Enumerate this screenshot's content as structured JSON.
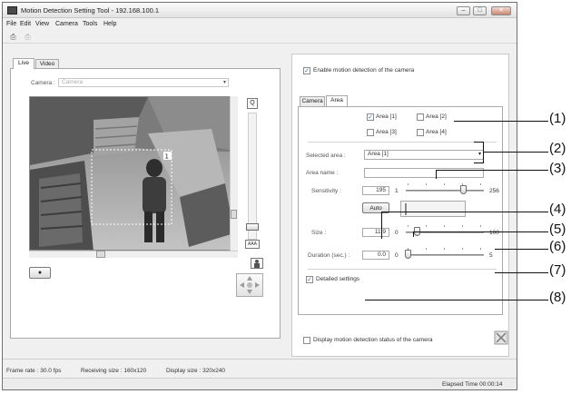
{
  "window": {
    "title": "Motion Detection Setting Tool - 192.168.100.1",
    "controls": {
      "minimize": "–",
      "maximize": "□",
      "close": "✕"
    }
  },
  "menu": [
    "File",
    "Edit",
    "View",
    "Camera",
    "Tools",
    "Help"
  ],
  "toolbar": {
    "icons": [
      "camera-connect-icon",
      "camera-disconnect-icon"
    ]
  },
  "left_panel": {
    "tabs": [
      "Live",
      "Video"
    ],
    "camera_label": "Camera :",
    "camera_value": "Camera",
    "zoom_label": "Q",
    "fit_label": "AAA",
    "record_symbol": "●"
  },
  "right_panel": {
    "enable_label": "Enable motion detection of the camera",
    "enable_checked": true,
    "tabs": [
      "Camera",
      "Area"
    ],
    "areas": [
      {
        "label": "Area [1]",
        "checked": true
      },
      {
        "label": "Area [2]",
        "checked": false
      },
      {
        "label": "Area [3]",
        "checked": false
      },
      {
        "label": "Area [4]",
        "checked": false
      }
    ],
    "selected_area_label": "Selected area :",
    "selected_area_value": "Area [1]",
    "area_name_label": "Area name :",
    "area_name_value": "",
    "sensitivity_label": "Sensitivity :",
    "sensitivity_value": "195",
    "sensitivity_min": "1",
    "sensitivity_max": "256",
    "sensitivity_level": 195,
    "auto_button": "Auto",
    "size_label": "Size :",
    "size_value": "11.9",
    "size_min": "0",
    "size_max": "100",
    "size_level": 11.9,
    "duration_label": "Duration (sec.) :",
    "duration_value": "0.0",
    "duration_min": "0",
    "duration_max": "5",
    "duration_level": 0,
    "detailed_label": "Detailed settings",
    "detailed_checked": true,
    "display_status_label": "Display motion detection status of the camera",
    "display_status_checked": false
  },
  "status": {
    "frame_rate": "Frame rate : 30.0 fps",
    "receiving_size": "Receiving size : 160x120",
    "display_size": "Display size : 320x240",
    "elapsed": "Elapsed Time 00:00:14"
  },
  "callouts": [
    "(1)",
    "(2)",
    "(3)",
    "(4)",
    "(5)",
    "(6)",
    "(7)",
    "(8)"
  ],
  "colors": {
    "accent": "#3a6ea5",
    "window_bg": "#f0f0f0",
    "panel_bg": "#ffffff"
  }
}
